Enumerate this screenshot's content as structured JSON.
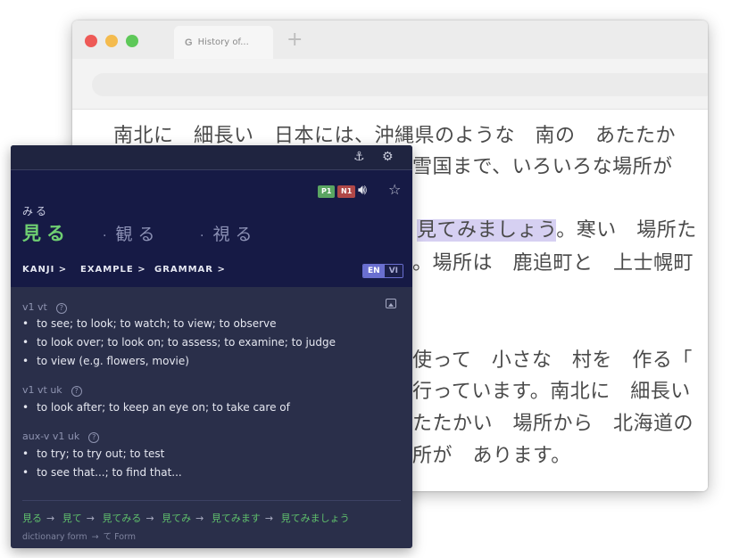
{
  "browser": {
    "tab_title": "History of...",
    "tab_icon": "G",
    "new_tab_symbol": "+",
    "article_lines": [
      "南北に　細長い　日本には、沖縄県のような　南の　あたたか",
      "雪国まで、いろいろな場所が",
      "。寒い　場所た",
      "。場所は　鹿追町と　上士幌町",
      "使って　小さな　村を　作る「",
      "行っています。南北に　細長い",
      "たたかい　場所から　北海道の",
      "所が　あります。"
    ],
    "highlighted_text": "見てみましょう"
  },
  "popup": {
    "badges": {
      "p1": "P1",
      "n1": "N1"
    },
    "reading": "みる",
    "word": "見る",
    "alternates": [
      "観る",
      "視る"
    ],
    "alt_separator": "·",
    "tabs": [
      "KANJI >",
      "EXAMPLE >",
      "GRAMMAR >"
    ],
    "languages": {
      "en": "EN",
      "vi": "VI"
    },
    "senses": [
      {
        "pos": "v1 vt",
        "glosses": [
          "to see; to look; to watch; to view; to observe",
          "to look over; to look on; to assess; to examine; to judge",
          "to view (e.g. flowers, movie)"
        ]
      },
      {
        "pos": "v1 vt uk",
        "glosses": [
          "to look after; to keep an eye on; to take care of"
        ]
      },
      {
        "pos": "aux-v v1 uk",
        "glosses": [
          "to try; to try out; to test",
          "to see that...; to find that..."
        ]
      }
    ],
    "conjugation_chain": [
      "見る",
      "見て",
      "見てみる",
      "見てみ",
      "見てみます",
      "見てみましょう"
    ],
    "conjugation_labels": [
      "dictionary form",
      "て Form"
    ],
    "arrow": "→"
  },
  "colors": {
    "popup_bg": "#2a2f4a",
    "popup_header_bg": "#161a45",
    "accent_green": "#6fcf72",
    "highlight": "#d6d0f2",
    "lang_active": "#6a6fd0"
  },
  "icons": [
    "anchor-icon",
    "gear-icon",
    "speaker-icon",
    "star-icon",
    "image-icon",
    "help-icon"
  ]
}
